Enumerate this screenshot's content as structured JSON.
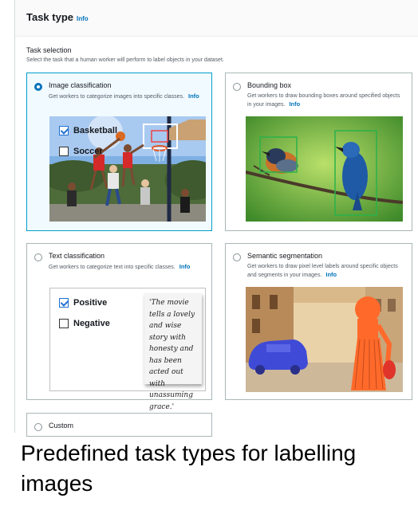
{
  "header": {
    "title": "Task type",
    "info": "Info"
  },
  "selection": {
    "label": "Task selection",
    "description": "Select the task that a human worker will perform to label objects in your dataset."
  },
  "cards": [
    {
      "title": "Image classification",
      "description": "Get workers to categorize images into specific classes.",
      "info": "Info",
      "selected": true,
      "checkboxes": [
        {
          "label": "Basketball",
          "checked": true
        },
        {
          "label": "Soccer",
          "checked": false
        }
      ]
    },
    {
      "title": "Bounding box",
      "description": "Get workers to draw bounding boxes around specified objects in your images.",
      "info": "Info",
      "selected": false
    },
    {
      "title": "Text classification",
      "description": "Get workers to categorize text into specific classes.",
      "info": "Info",
      "selected": false,
      "checkboxes": [
        {
          "label": "Positive",
          "checked": true
        },
        {
          "label": "Negative",
          "checked": false
        }
      ],
      "quote": "'The movie tells a lovely and wise story with honesty and has been acted out with unassuming grace.'"
    },
    {
      "title": "Semantic segmentation",
      "description": "Get workers to draw pixel level labels around specific objects and segments in your images.",
      "info": "Info",
      "selected": false
    },
    {
      "title": "Custom",
      "selected": false
    }
  ],
  "caption": "Predefined task types for labelling images",
  "colors": {
    "accent": "#0073bb",
    "selected_border": "#00a1c9",
    "bbox_green": "#2bb14a",
    "segmentation_orange": "#ff6a2b",
    "segmentation_blue": "#3f4bd6"
  }
}
